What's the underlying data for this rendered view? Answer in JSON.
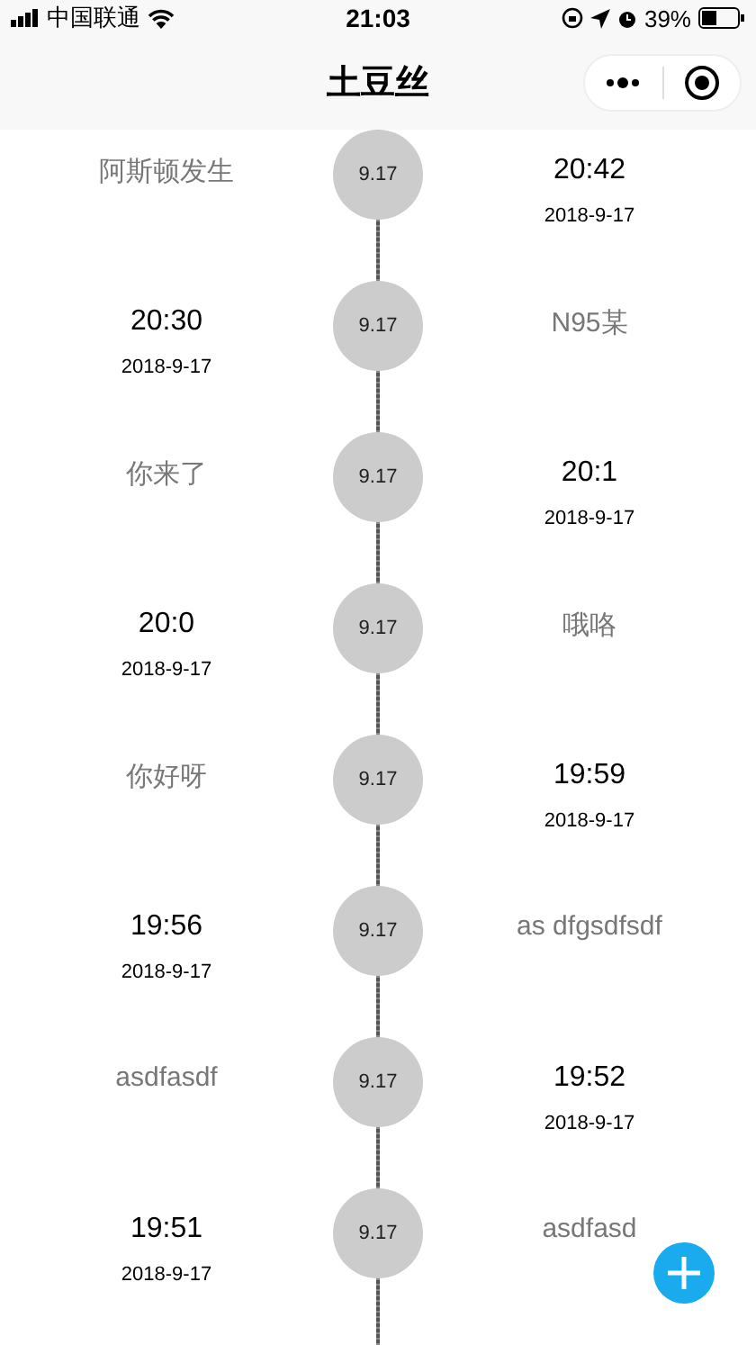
{
  "status_bar": {
    "carrier": "中国联通",
    "time": "21:03",
    "battery": "39%"
  },
  "nav_bar": {
    "title": "土豆丝"
  },
  "timeline": [
    {
      "title": "阿斯顿发生",
      "time": "20:42",
      "date": "2018-9-17",
      "badge": "9.17",
      "kind": "titleleft"
    },
    {
      "title": "N95某",
      "time": "20:30",
      "date": "2018-9-17",
      "badge": "9.17",
      "kind": "titleright"
    },
    {
      "title": "你来了",
      "time": "20:1",
      "date": "2018-9-17",
      "badge": "9.17",
      "kind": "titleleft"
    },
    {
      "title": "哦咯",
      "time": "20:0",
      "date": "2018-9-17",
      "badge": "9.17",
      "kind": "titleright"
    },
    {
      "title": "你好呀",
      "time": "19:59",
      "date": "2018-9-17",
      "badge": "9.17",
      "kind": "titleleft"
    },
    {
      "title": "as dfgsdfsdf",
      "time": "19:56",
      "date": "2018-9-17",
      "badge": "9.17",
      "kind": "titleright"
    },
    {
      "title": "asdfasdf",
      "time": "19:52",
      "date": "2018-9-17",
      "badge": "9.17",
      "kind": "titleleft"
    },
    {
      "title": "asdfasd",
      "time": "19:51",
      "date": "2018-9-17",
      "badge": "9.17",
      "kind": "titleright"
    }
  ]
}
